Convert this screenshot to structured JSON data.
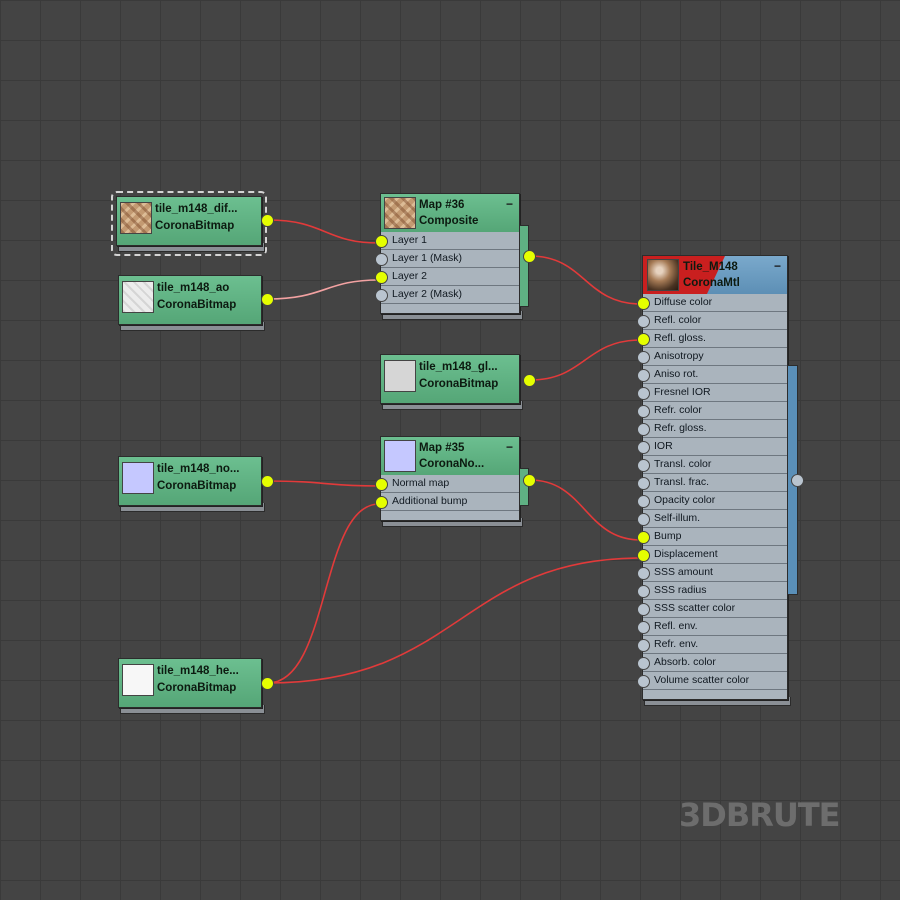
{
  "nodes": {
    "diffuse": {
      "name": "tile_m148_dif...",
      "type": "CoronaBitmap"
    },
    "ao": {
      "name": "tile_m148_ao",
      "type": "CoronaBitmap"
    },
    "gloss": {
      "name": "tile_m148_gl...",
      "type": "CoronaBitmap"
    },
    "normal": {
      "name": "tile_m148_no...",
      "type": "CoronaBitmap"
    },
    "height": {
      "name": "tile_m148_he...",
      "type": "CoronaBitmap"
    },
    "composite": {
      "name": "Map #36",
      "type": "Composite",
      "slots": [
        "Layer 1",
        "Layer 1 (Mask)",
        "Layer 2",
        "Layer 2 (Mask)"
      ]
    },
    "normalmap": {
      "name": "Map #35",
      "type": "CoronaNo...",
      "slots": [
        "Normal map",
        "Additional bump"
      ]
    },
    "material": {
      "name": "Tile_M148",
      "type": "CoronaMtl",
      "slots": [
        "Diffuse color",
        "Refl. color",
        "Refl. gloss.",
        "Anisotropy",
        "Aniso rot.",
        "Fresnel IOR",
        "Refr. color",
        "Refr. gloss.",
        "IOR",
        "Transl. color",
        "Transl. frac.",
        "Opacity color",
        "Self-illum.",
        "Bump",
        "Displacement",
        "SSS amount",
        "SSS radius",
        "SSS scatter color",
        "Refl. env.",
        "Refr. env.",
        "Absorb. color",
        "Volume scatter color"
      ]
    }
  },
  "minimize_symbol": "−",
  "watermark": "3DBRUTE",
  "colors": {
    "canvas": "#444444",
    "wire": "#e23a3a",
    "wire_selected": "#f3a2a2",
    "socket_connected": "#e5ff00",
    "socket_empty": "#b9c4cf",
    "map_header": "#5fb083",
    "material_header": "#6a9cc2",
    "selection_marker": "#c91f1f"
  },
  "icons": {
    "diffuse_thumb": "tile-pattern-thumbnail",
    "ao_thumb": "white-ao-thumbnail",
    "gloss_thumb": "grey-gloss-thumbnail",
    "normal_thumb": "lavender-normal-thumbnail",
    "height_thumb": "white-height-thumbnail",
    "composite_thumb": "tile-pattern-thumbnail",
    "normalmap_thumb": "lavender-normal-thumbnail",
    "material_thumb": "material-sphere-thumbnail"
  }
}
